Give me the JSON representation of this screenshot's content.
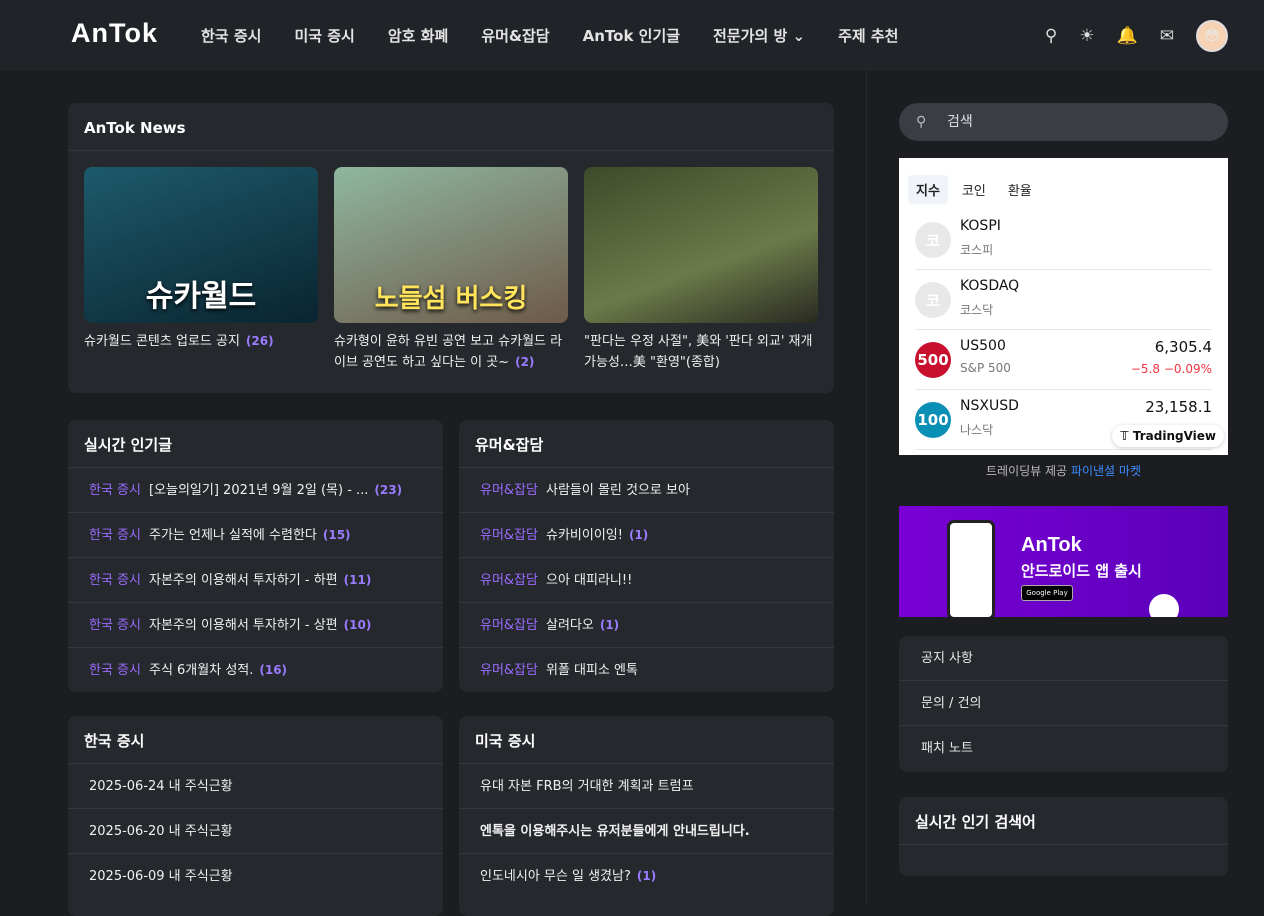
{
  "header": {
    "logo": "AnTok",
    "nav": [
      "한국 증시",
      "미국 증시",
      "암호 화폐",
      "유머&잡담",
      "AnTok 인기글",
      "전문가의 방 ⌄",
      "주제 추천"
    ]
  },
  "news": {
    "title": "AnTok News",
    "items": [
      {
        "thumb_text": "슈카월드",
        "title": "슈카월드 콘텐츠 업로드 공지",
        "count": "(26)"
      },
      {
        "thumb_text": "노들섬 버스킹",
        "title": "슈카형이 윤하 유빈 공연 보고 슈카월드 라이브 공연도 하고 싶다는 이 곳~",
        "count": "(2)"
      },
      {
        "thumb_text": "",
        "title": "\"판다는 우정 사절\", 美와 '판다 외교' 재개 가능성…美 \"환영\"(종합)",
        "count": ""
      }
    ]
  },
  "popular": {
    "title": "실시간 인기글",
    "rows": [
      {
        "cat": "한국 증시",
        "title": "[오늘의일기] 2021년 9월 2일 (목) - ...",
        "count": "(23)"
      },
      {
        "cat": "한국 증시",
        "title": "주가는 언제나 실적에 수렴한다",
        "count": "(15)"
      },
      {
        "cat": "한국 증시",
        "title": "자본주의 이용해서 투자하기 - 하편",
        "count": "(11)"
      },
      {
        "cat": "한국 증시",
        "title": "자본주의 이용해서 투자하기 - 상편",
        "count": "(10)"
      },
      {
        "cat": "한국 증시",
        "title": "주식 6개월차 성적.",
        "count": "(16)"
      }
    ]
  },
  "humor": {
    "title": "유머&잡담",
    "rows": [
      {
        "cat": "유머&잡담",
        "title": "사람들이 몰린 것으로 보아",
        "count": ""
      },
      {
        "cat": "유머&잡담",
        "title": "슈카비이이잉!",
        "count": "(1)"
      },
      {
        "cat": "유머&잡담",
        "title": "으아 대피라니!!",
        "count": ""
      },
      {
        "cat": "유머&잡담",
        "title": "살려다오",
        "count": "(1)"
      },
      {
        "cat": "유머&잡담",
        "title": "위폴 대피소 엔톡",
        "count": ""
      }
    ]
  },
  "korea": {
    "title": "한국 증시",
    "rows": [
      {
        "title": "2025-06-24 내 주식근황"
      },
      {
        "title": "2025-06-20 내 주식근황"
      },
      {
        "title": "2025-06-09 내 주식근황"
      }
    ]
  },
  "us": {
    "title": "미국 증시",
    "rows": [
      {
        "title": "유대 자본 FRB의 거대한 계획과 트럼프",
        "count": ""
      },
      {
        "title": "엔톡을 이용해주시는 유저분들에게 안내드립니다.",
        "count": ""
      },
      {
        "title": "인도네시아 무슨 일 생겼남?",
        "count": "(1)"
      }
    ]
  },
  "search": {
    "placeholder": "검색"
  },
  "market": {
    "tabs": [
      "지수",
      "코인",
      "환율"
    ],
    "symbols": [
      {
        "icon": "코",
        "name": "KOSPI",
        "desc": "코스피",
        "value": "",
        "change": "",
        "color": "#e8e8e8"
      },
      {
        "icon": "코",
        "name": "KOSDAQ",
        "desc": "코스닥",
        "value": "",
        "change": "",
        "color": "#e8e8e8"
      },
      {
        "icon": "500",
        "name": "US500",
        "desc": "S&P 500",
        "value": "6,305.4",
        "change": "−5.8  −0.09%",
        "color": "#c8102e"
      },
      {
        "icon": "100",
        "name": "NSXUSD",
        "desc": "나스닥",
        "value": "23,158.1",
        "change": "",
        "color": "#0a8fb5"
      }
    ],
    "badge": "TradingView",
    "credit": "트레이딩뷰 제공",
    "credit_link": "파이낸셜 마켓"
  },
  "banner": {
    "logo": "AnTok",
    "text": "안드로이드 앱 출시",
    "store": "Google Play"
  },
  "links": [
    "공지 사항",
    "문의 / 건의",
    "패치 노트"
  ],
  "trending": {
    "title": "실시간 인기 검색어"
  }
}
